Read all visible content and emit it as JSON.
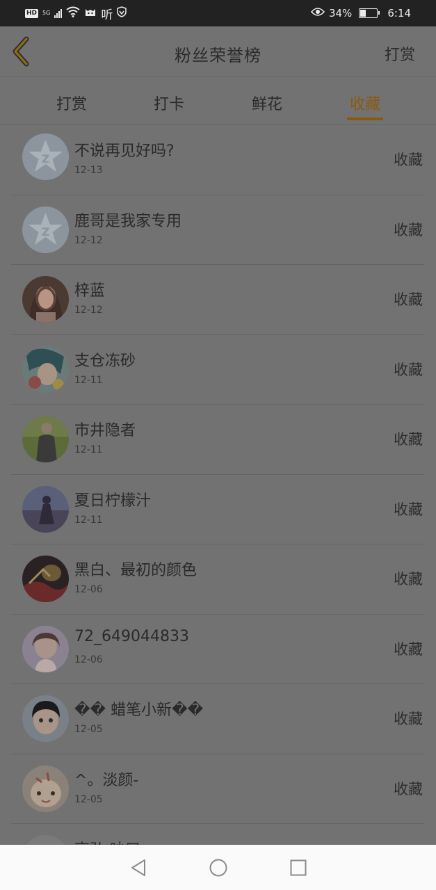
{
  "status_bar": {
    "hd": "HD",
    "network": "5G",
    "listen": "听",
    "battery_text": "34%",
    "battery_level": 0.34,
    "time": "6:14"
  },
  "header": {
    "title": "粉丝荣誉榜",
    "action": "打赏"
  },
  "tabs": [
    {
      "label": "打赏"
    },
    {
      "label": "打卡"
    },
    {
      "label": "鲜花"
    },
    {
      "label": "收藏"
    }
  ],
  "active_tab": "收藏",
  "list": [
    {
      "name": "不说再见好吗?",
      "date": "12-13",
      "action": "收藏"
    },
    {
      "name": "鹿哥是我家专用",
      "date": "12-12",
      "action": "收藏"
    },
    {
      "name": "梓蓝",
      "date": "12-12",
      "action": "收藏"
    },
    {
      "name": "支仓冻砂",
      "date": "12-11",
      "action": "收藏"
    },
    {
      "name": "市井隐者",
      "date": "12-11",
      "action": "收藏"
    },
    {
      "name": "夏日柠檬汁",
      "date": "12-11",
      "action": "收藏"
    },
    {
      "name": "黑白、最初的颜色",
      "date": "12-06",
      "action": "收藏"
    },
    {
      "name": "72_649044833",
      "date": "12-06",
      "action": "收藏"
    },
    {
      "name": "�� 蜡笔小新��",
      "date": "12-05",
      "action": "收藏"
    },
    {
      "name": "^。淡颜-",
      "date": "12-05",
      "action": "收藏"
    },
    {
      "name": "高弘 吵曰",
      "date": "",
      "action": ""
    }
  ],
  "colors": {
    "overlay_bg": "#727272",
    "accent": "#8a5a0c",
    "status_bar": "#222222",
    "nav_bar": "#fafafa"
  }
}
